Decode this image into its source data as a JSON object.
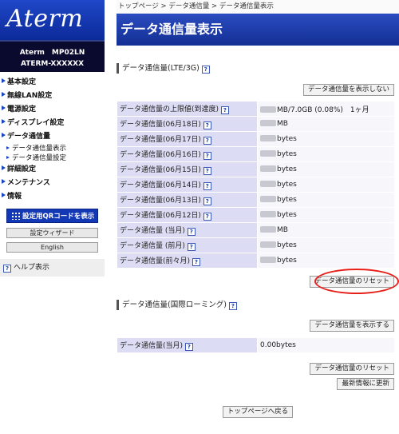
{
  "sidebar": {
    "logo": "Aterm",
    "model_line1": "Aterm　MP02LN",
    "model_line2": "ATERM-XXXXXX",
    "menu": [
      {
        "label": "基本設定"
      },
      {
        "label": "無線LAN設定"
      },
      {
        "label": "電源設定"
      },
      {
        "label": "ディスプレイ設定"
      },
      {
        "label": "データ通信量"
      }
    ],
    "submenu": [
      {
        "label": "データ通信量表示"
      },
      {
        "label": "データ通信量設定"
      }
    ],
    "menu2": [
      {
        "label": "詳細設定"
      },
      {
        "label": "メンテナンス"
      },
      {
        "label": "情報"
      }
    ],
    "qr_button": "設定用QRコードを表示",
    "wizard_button": "設定ウィザード",
    "english_button": "English",
    "help": "ヘルプ表示"
  },
  "breadcrumb": "トップページ > データ通信量 > データ通信量表示",
  "page_title": "データ通信量表示",
  "lte": {
    "section_title": "データ通信量(LTE/3G)",
    "hide_button": "データ通信量を表示しない",
    "rows": [
      {
        "label": "データ通信量の上限値(到達度)",
        "value": "MB/7.0GB (0.08%)　1ヶ月"
      },
      {
        "label": "データ通信量(06月18日)",
        "value": "MB"
      },
      {
        "label": "データ通信量(06月17日)",
        "value": "bytes"
      },
      {
        "label": "データ通信量(06月16日)",
        "value": "bytes"
      },
      {
        "label": "データ通信量(06月15日)",
        "value": "bytes"
      },
      {
        "label": "データ通信量(06月14日)",
        "value": "bytes"
      },
      {
        "label": "データ通信量(06月13日)",
        "value": "bytes"
      },
      {
        "label": "データ通信量(06月12日)",
        "value": "bytes"
      },
      {
        "label": "データ通信量 (当月)",
        "value": "MB"
      },
      {
        "label": "データ通信量 (前月)",
        "value": "bytes"
      },
      {
        "label": "データ通信量(前々月)",
        "value": "bytes"
      }
    ],
    "reset_button": "データ通信量のリセット"
  },
  "roaming": {
    "section_title": "データ通信量(国際ローミング)",
    "show_button": "データ通信量を表示する",
    "row_label": "データ通信量(当月)",
    "row_value": "0.00bytes",
    "reset_button": "データ通信量のリセット",
    "refresh_button": "最新情報に更新"
  },
  "back_button": "トップページへ戻る",
  "help_icon_text": "?",
  "colors": {
    "accent": "#1c3fa8",
    "highlight_circle": "#e8201a"
  }
}
